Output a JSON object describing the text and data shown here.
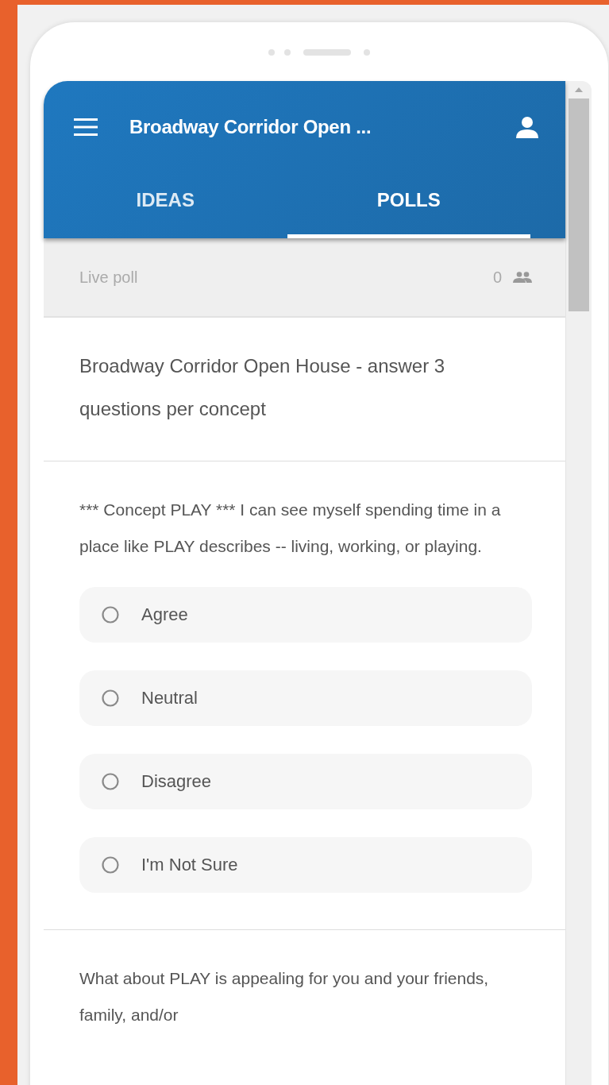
{
  "app_bar": {
    "title": "Broadway Corridor Open ..."
  },
  "tabs": [
    {
      "label": "IDEAS",
      "selected": false
    },
    {
      "label": "POLLS",
      "selected": true
    }
  ],
  "poll_bar": {
    "label": "Live poll",
    "participants": "0"
  },
  "poll_title": "Broadway Corridor Open House - answer 3 questions per concept",
  "questions": [
    {
      "text": "*** Concept PLAY *** I can see myself spending time in a place like PLAY describes -- living, working, or playing.",
      "options": [
        {
          "label": "Agree",
          "selected": false
        },
        {
          "label": "Neutral",
          "selected": false
        },
        {
          "label": "Disagree",
          "selected": false
        },
        {
          "label": "I'm Not Sure",
          "selected": false
        }
      ]
    },
    {
      "text": "What about PLAY is appealing for you and your friends, family, and/or"
    }
  ]
}
